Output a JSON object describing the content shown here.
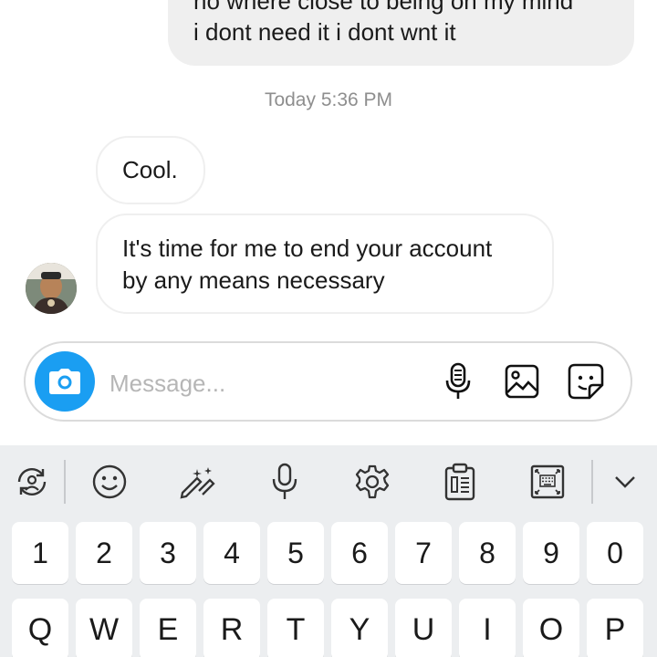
{
  "conversation": {
    "outgoing_message": {
      "lines": [
        "no where close to being on my mind",
        "i dont need it i dont wnt it"
      ]
    },
    "timestamp": "Today 5:36 PM",
    "incoming_messages": [
      {
        "lines": [
          "Cool."
        ]
      },
      {
        "lines": [
          "It's time for me to end your account",
          "by any means necessary"
        ]
      }
    ]
  },
  "composer": {
    "placeholder": "Message...",
    "icons": [
      "camera-icon",
      "mic-icon",
      "gallery-icon",
      "sticker-icon"
    ]
  },
  "keyboard": {
    "toolbar_icons": [
      "translate-icon",
      "emoji-icon",
      "handwriting-icon",
      "voice-icon",
      "settings-icon",
      "clipboard-icon",
      "keyboard-mode-icon",
      "collapse-icon"
    ],
    "number_row": [
      "1",
      "2",
      "3",
      "4",
      "5",
      "6",
      "7",
      "8",
      "9",
      "0"
    ],
    "letter_row": [
      "Q",
      "W",
      "E",
      "R",
      "T",
      "Y",
      "U",
      "I",
      "O",
      "P"
    ]
  },
  "colors": {
    "accent": "#1a9ef2",
    "bubble_out": "#efefef",
    "keyboard_bg": "#eceef0",
    "timestamp": "#8e8e8e"
  }
}
